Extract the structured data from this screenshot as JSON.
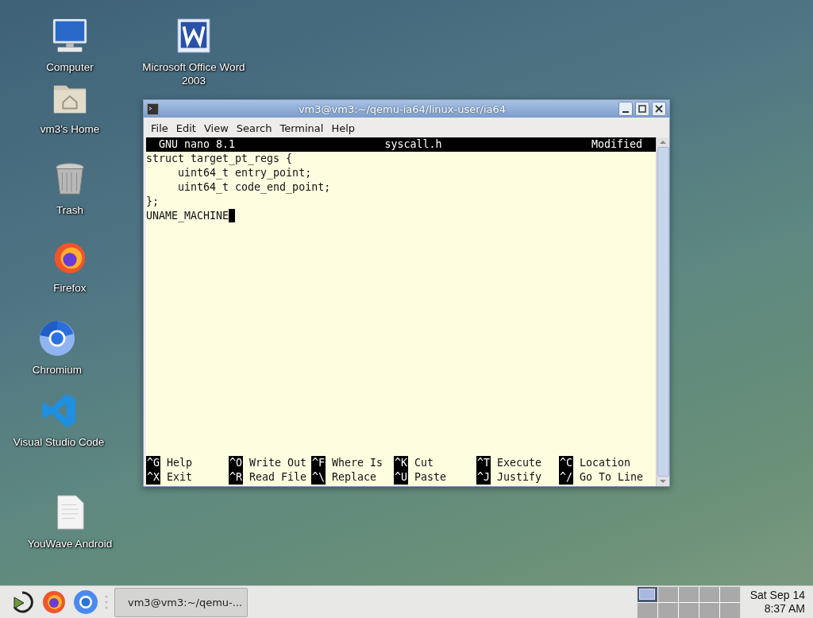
{
  "desktop_icons": [
    {
      "label": "Computer",
      "kind": "computer"
    },
    {
      "label": "Microsoft Office Word 2003",
      "kind": "word"
    },
    {
      "label": "vm3's Home",
      "kind": "home"
    },
    {
      "label": "Trash",
      "kind": "trash"
    },
    {
      "label": "Firefox",
      "kind": "firefox"
    },
    {
      "label": "Chromium",
      "kind": "chromium"
    },
    {
      "label": "Visual Studio Code",
      "kind": "vscode"
    },
    {
      "label": "YouWave Android",
      "kind": "document"
    }
  ],
  "window": {
    "title": "vm3@vm3:~/qemu-ia64/linux-user/ia64",
    "menu": [
      "File",
      "Edit",
      "View",
      "Search",
      "Terminal",
      "Help"
    ],
    "nano": {
      "version": "GNU nano 8.1",
      "filename": "syscall.h",
      "state": "Modified",
      "lines": [
        "struct target_pt_regs {",
        "     uint64_t entry_point;",
        "     uint64_t code_end_point;",
        "};",
        "UNAME_MACHINE"
      ],
      "shortcut_rows": [
        [
          {
            "key": "^G",
            "label": "Help"
          },
          {
            "key": "^O",
            "label": "Write Out"
          },
          {
            "key": "^F",
            "label": "Where Is"
          },
          {
            "key": "^K",
            "label": "Cut"
          },
          {
            "key": "^T",
            "label": "Execute"
          },
          {
            "key": "^C",
            "label": "Location"
          }
        ],
        [
          {
            "key": "^X",
            "label": "Exit"
          },
          {
            "key": "^R",
            "label": "Read File"
          },
          {
            "key": "^\\",
            "label": "Replace"
          },
          {
            "key": "^U",
            "label": "Paste"
          },
          {
            "key": "^J",
            "label": "Justify"
          },
          {
            "key": "^/",
            "label": "Go To Line"
          }
        ]
      ]
    }
  },
  "taskbar": {
    "launchers": [
      {
        "kind": "restore"
      },
      {
        "kind": "firefox"
      },
      {
        "kind": "chromium"
      }
    ],
    "tasks": [
      {
        "label": "vm3@vm3:~/qemu-..."
      }
    ],
    "workspaces": [
      {
        "selected": true
      },
      {
        "selected": false
      },
      {
        "selected": false
      },
      {
        "selected": false
      },
      {
        "selected": false
      },
      {
        "selected": false
      },
      {
        "selected": false
      },
      {
        "selected": false
      },
      {
        "selected": false
      },
      {
        "selected": false
      }
    ],
    "clock": [
      "Sat Sep 14",
      "8:37 AM"
    ]
  }
}
